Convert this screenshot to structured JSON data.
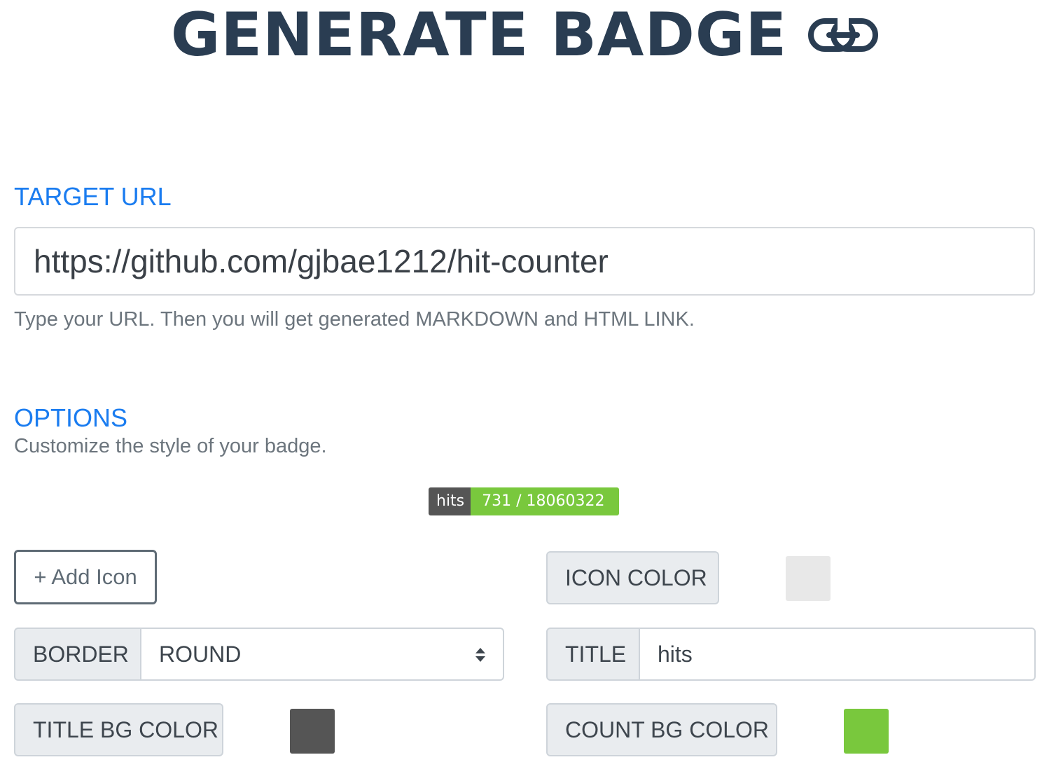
{
  "header": {
    "title": "GENERATE BADGE",
    "title_icon": "link-icon"
  },
  "target_url": {
    "heading": "TARGET URL",
    "input_value": "https://github.com/gjbae1212/hit-counter",
    "help": "Type your URL. Then you will get generated MARKDOWN and HTML LINK."
  },
  "options": {
    "heading": "OPTIONS",
    "subtitle": "Customize the style of your badge."
  },
  "badge": {
    "title": "hits",
    "count": "731 / 18060322",
    "title_bg_color": "#555555",
    "count_bg_color": "#79c83d"
  },
  "controls": {
    "add_icon_label": "+ Add Icon",
    "icon_color_label": "ICON COLOR",
    "icon_color_value": "#e8e8e8",
    "border_label": "BORDER",
    "border_value": "ROUND",
    "title_label": "TITLE",
    "title_value": "hits",
    "title_bg_color_label": "TITLE BG COLOR",
    "title_bg_color_value": "#555555",
    "count_bg_color_label": "COUNT BG COLOR",
    "count_bg_color_value": "#79c83d"
  }
}
